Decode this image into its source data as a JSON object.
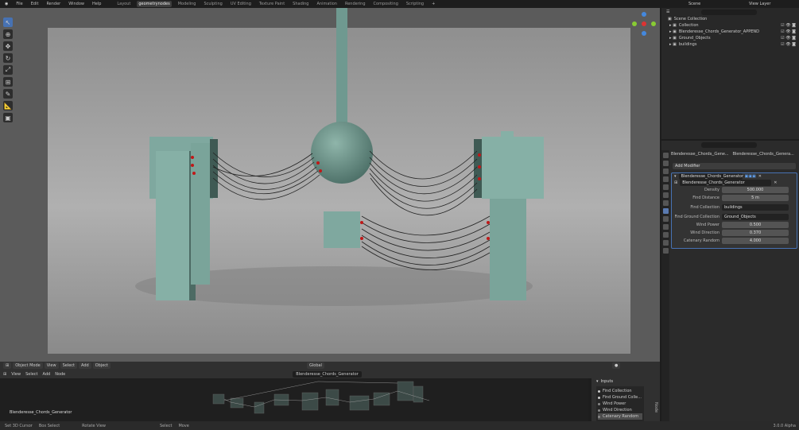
{
  "menu": {
    "items": [
      "File",
      "Edit",
      "Render",
      "Window",
      "Help"
    ],
    "workspaces": [
      "Layout",
      "geometrynodes",
      "Modeling",
      "Sculpting",
      "UV Editing",
      "Texture Paint",
      "Shading",
      "Animation",
      "Rendering",
      "Compositing",
      "Scripting"
    ],
    "active_workspace": "geometrynodes"
  },
  "topright": {
    "scene": "Scene",
    "view_layer": "View Layer"
  },
  "outliner": {
    "root": "Scene Collection",
    "items": [
      "Collection",
      "Blenderesse_Chords_Generator_APPEND",
      "Ground_Objects",
      "buildings"
    ]
  },
  "properties": {
    "breadcrumb": [
      "Blenderesse_Chords_Gene...",
      "Blenderesse_Chords_Genera..."
    ],
    "add_modifier": "Add Modifier",
    "modifier_name": "Blenderesse_Chords_Generator",
    "node_group": "Blenderesse_Chords_Generator",
    "fields": [
      {
        "label": "Density",
        "value": "500.000"
      },
      {
        "label": "Find Distance",
        "value": "5 m"
      },
      {
        "label": "Find Collection",
        "value": "buildings",
        "type": "collection"
      },
      {
        "label": "Find Ground Collection",
        "value": "Ground_Objects",
        "type": "collection"
      },
      {
        "label": "Wind Power",
        "value": "0.500"
      },
      {
        "label": "Wind Direction",
        "value": "0.370"
      },
      {
        "label": "Catenary Random",
        "value": "4.000"
      }
    ]
  },
  "viewport_header": {
    "mode": "Object Mode",
    "menus": [
      "View",
      "Select",
      "Add",
      "Object"
    ],
    "orientation": "Global"
  },
  "node_editor": {
    "menus": [
      "View",
      "Select",
      "Add",
      "Node"
    ],
    "node_tree": "Blenderesse_Chords_Generator",
    "label": "Blenderesse_Chords_Generator"
  },
  "inputs_panel": {
    "title": "Inputs",
    "items": [
      "Find Collection",
      "Find Ground Colle...",
      "Wind Power",
      "Wind Direction",
      "Catenary Random"
    ],
    "selected": "Catenary Random",
    "side_tab": "Node"
  },
  "status": {
    "items": [
      "Set 3D Cursor",
      "Box Select",
      "Rotate View",
      "Select",
      "Move"
    ],
    "version": "3.0.0 Alpha"
  }
}
